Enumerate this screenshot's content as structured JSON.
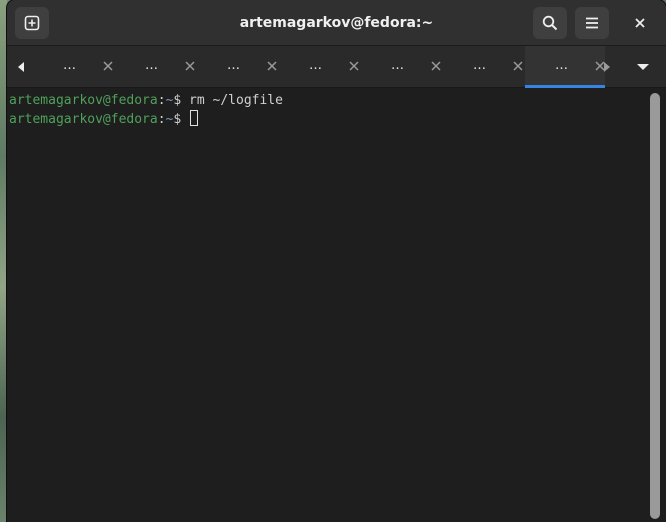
{
  "window": {
    "title": "artemagarkov@fedora:~"
  },
  "headerbar": {
    "new_tab_icon": "new-tab-icon",
    "search_icon": "search-icon",
    "menu_icon": "hamburger-menu-icon",
    "close_icon": "close-icon"
  },
  "tabs": [
    {
      "label": "…",
      "active": false
    },
    {
      "label": "…",
      "active": false
    },
    {
      "label": "…",
      "active": false
    },
    {
      "label": "…",
      "active": false
    },
    {
      "label": "…",
      "active": false
    },
    {
      "label": "…",
      "active": false
    },
    {
      "label": "…",
      "active": true
    }
  ],
  "colors": {
    "accent": "#3584e4",
    "prompt_user": "#4fa05a",
    "prompt_path": "#7a93c8",
    "background": "#1e1e1e"
  },
  "terminal": {
    "lines": [
      {
        "user": "artemagarkov@fedora",
        "sep": ":",
        "path": "~",
        "prompt": "$ ",
        "command": "rm ~/logfile"
      },
      {
        "user": "artemagarkov@fedora",
        "sep": ":",
        "path": "~",
        "prompt": "$ ",
        "command": ""
      }
    ]
  }
}
